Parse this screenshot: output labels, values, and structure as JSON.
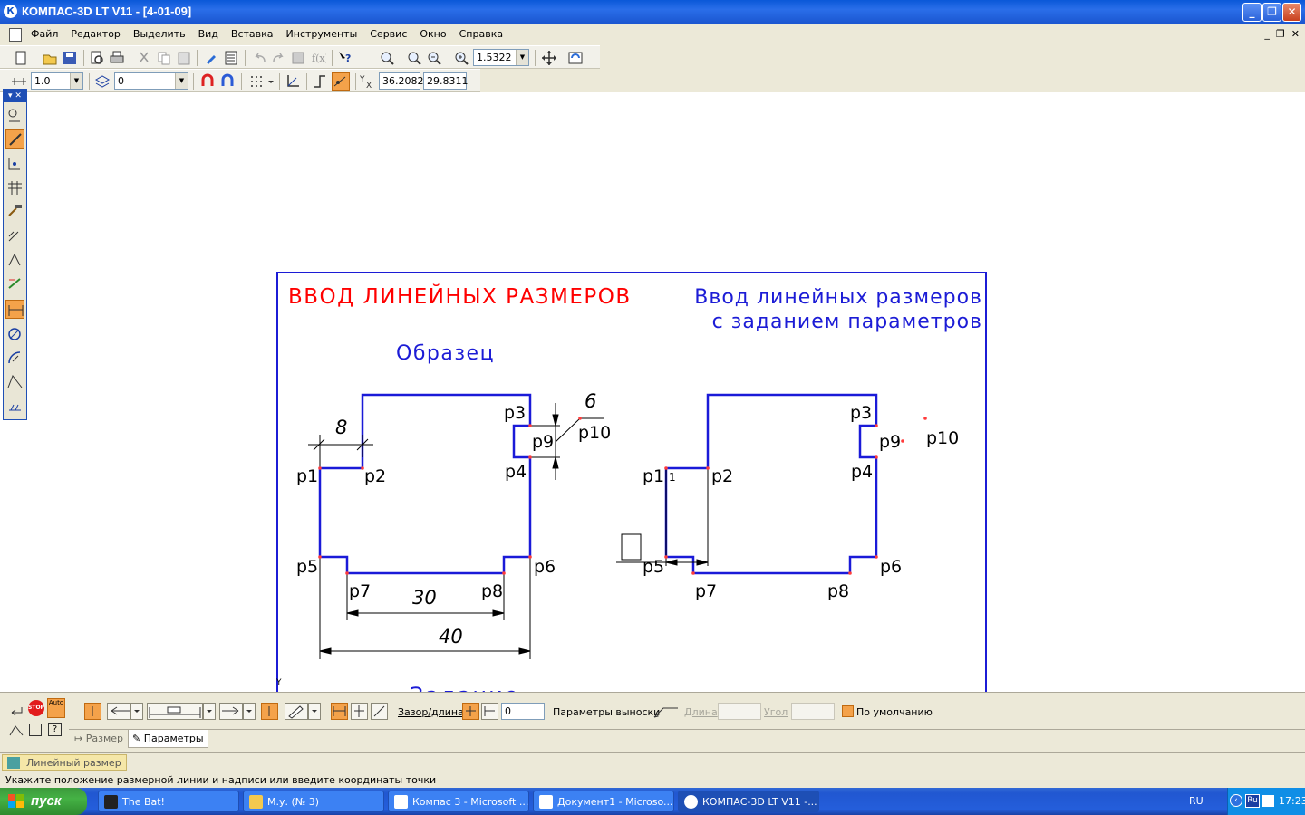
{
  "window": {
    "title": "КОМПАС-3D LT V11 - [4-01-09]",
    "app_icon_letter": "К"
  },
  "menu": {
    "items": [
      "Файл",
      "Редактор",
      "Выделить",
      "Вид",
      "Вставка",
      "Инструменты",
      "Сервис",
      "Окно",
      "Справка"
    ]
  },
  "toolbar": {
    "zoom_value": "1.5322",
    "step_value": "1.0",
    "layer_value": "0",
    "coord_x": "36.2082",
    "coord_y": "29.8311"
  },
  "drawing": {
    "heading_left": "ВВОД ЛИНЕЙНЫХ РАЗМЕРОВ",
    "heading_right_line1": "Ввод линейных размеров",
    "heading_right_line2": "с заданием параметров",
    "sample_label": "Образец",
    "partial_bottom_text": "Задание",
    "point_labels": [
      "p1",
      "p2",
      "p3",
      "p4",
      "p5",
      "p6",
      "p7",
      "p8",
      "p9",
      "p10"
    ],
    "dim_values": [
      "8",
      "6",
      "30",
      "40"
    ],
    "dim_preview_value": "1",
    "colors": {
      "frame": "#1c1cd6",
      "contour": "#1a1ad8",
      "red_heading": "#ff0000",
      "points": "#ff3b3b"
    }
  },
  "property_panel": {
    "gap_length_label": "Зазор/длина",
    "gap_value": "0",
    "leader_params_label": "Параметры выноски",
    "length_label": "Длина",
    "angle_label": "Угол",
    "default_label": "По умолчанию",
    "auto_label": "Auto",
    "stop_label": "STOP",
    "tab_size": "Размер",
    "tab_params": "Параметры"
  },
  "command": {
    "name": "Линейный размер"
  },
  "status": {
    "prompt": "Укажите положение размерной линии и надписи или введите координаты точки"
  },
  "taskbar": {
    "start_label": "пуск",
    "tasks": [
      "The Bat!",
      "М.у. (№ 3)",
      "Компас 3 - Microsoft ...",
      "Документ1 - Microso...",
      "КОМПАС-3D LT V11 -..."
    ],
    "lang": "RU",
    "lang_badge": "Ru",
    "time": "17:23"
  }
}
